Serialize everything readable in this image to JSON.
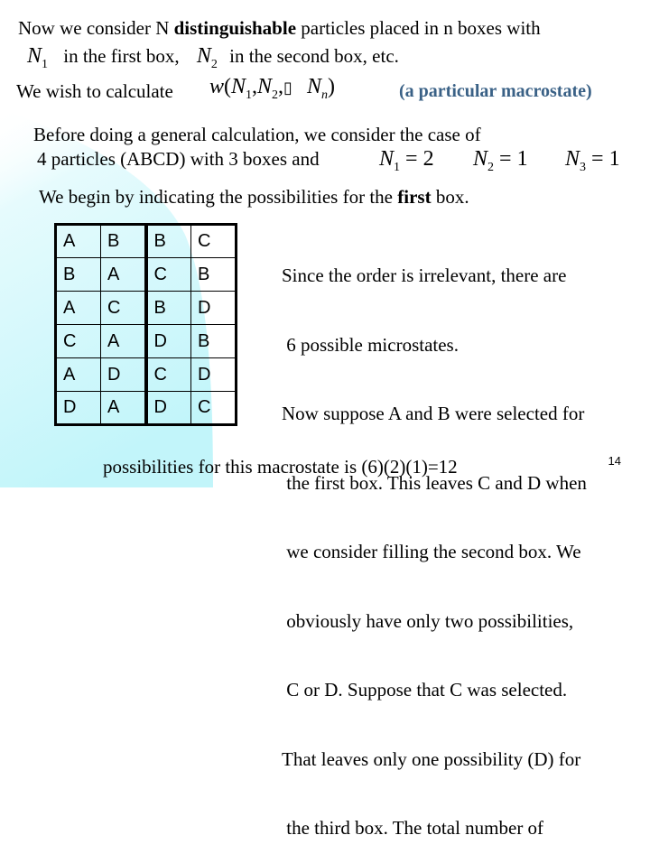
{
  "slide": {
    "page_number": "14",
    "accent_color": "#3a6186",
    "background_tint": "#c8f6fb"
  },
  "intro": {
    "line1_pre": "Now we consider N ",
    "line1_bold": "distinguishable",
    "line1_post": " particles placed in n boxes with",
    "n1_symbol": "N",
    "n1_sub": "1",
    "line2_mid": "in the first box,",
    "n2_symbol": "N",
    "n2_sub": "2",
    "line2_post": "in the second box, etc."
  },
  "goal": {
    "label": "We wish to calculate",
    "formula_w": "w",
    "formula_open": "(",
    "f_n1": "N",
    "f_n1_sub": "1",
    "f_comma1": ",",
    "f_n2": "N",
    "f_n2_sub": "2",
    "f_comma2": ",",
    "f_missing_glyph": "▯",
    "f_nn": "N",
    "f_nn_sub": "n",
    "formula_close": ")",
    "note": "(a particular macrostate)"
  },
  "example": {
    "line1": "Before doing a general calculation, we consider the case of",
    "line2": "4 particles (ABCD) with 3 boxes and",
    "conditions": [
      {
        "symbol": "N",
        "sub": "1",
        "eq": "=",
        "value": "2"
      },
      {
        "symbol": "N",
        "sub": "2",
        "eq": "=",
        "value": "1"
      },
      {
        "symbol": "N",
        "sub": "3",
        "eq": "=",
        "value": "1"
      }
    ]
  },
  "first_box": {
    "pre": "We begin by indicating the possibilities  for the ",
    "bold": "first",
    "post": " box."
  },
  "table": {
    "rows": [
      [
        "A",
        "B",
        "B",
        "C"
      ],
      [
        "B",
        "A",
        "C",
        "B"
      ],
      [
        "A",
        "C",
        "B",
        "D"
      ],
      [
        "C",
        "A",
        "D",
        "B"
      ],
      [
        "A",
        "D",
        "C",
        "D"
      ],
      [
        "D",
        "A",
        "D",
        "C"
      ]
    ]
  },
  "explanation": {
    "lines": [
      "Since the order is irrelevant, there are",
      " 6 possible microstates.",
      "Now suppose A and B were selected for",
      " the first box. This leaves C and D when",
      " we consider filling the second box. We",
      " obviously have only two possibilities,",
      " C or D. Suppose that C was selected.",
      "That leaves only one possibility (D) for",
      " the third box. The total number of"
    ],
    "final_line": "possibilities for this macrostate is (6)(2)(1)=12"
  }
}
